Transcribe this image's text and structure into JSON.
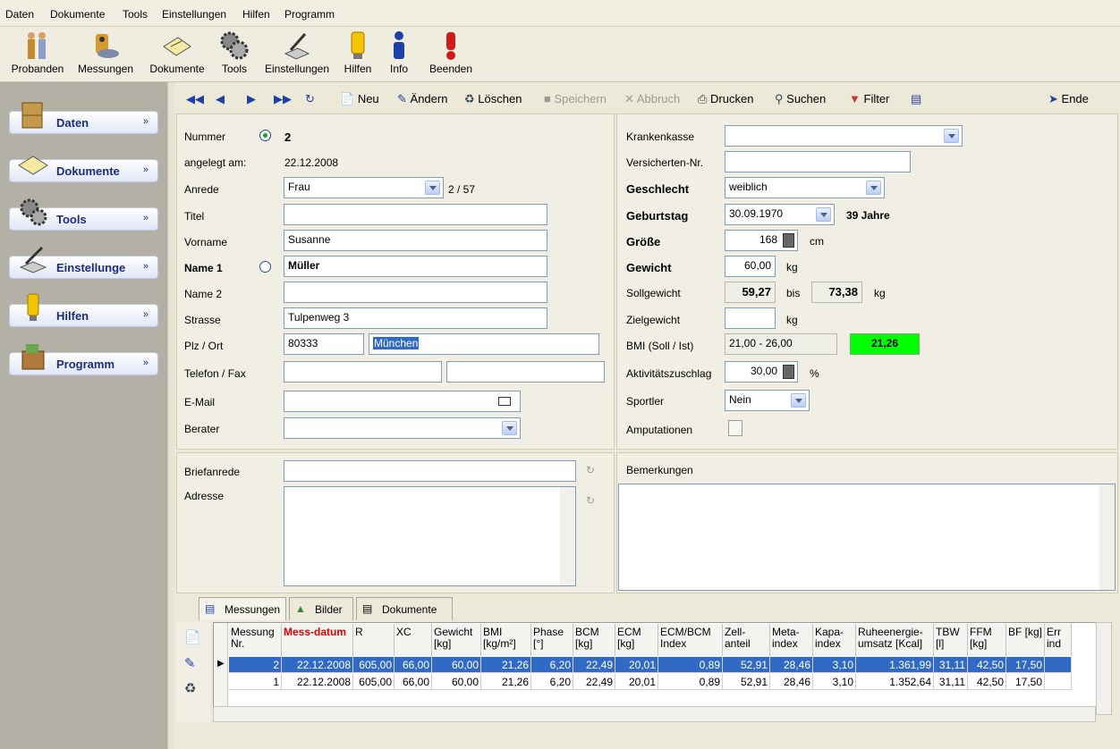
{
  "menu": [
    "Daten",
    "Dokumente",
    "Tools",
    "Einstellungen",
    "Hilfen",
    "Programm"
  ],
  "toolbar": [
    "Probanden",
    "Messungen",
    "Dokumente",
    "Tools",
    "Einstellungen",
    "Hilfen",
    "Info",
    "Beenden"
  ],
  "sidebar": [
    "Daten",
    "Dokumente",
    "Tools",
    "Einstellunge",
    "Hilfen",
    "Programm"
  ],
  "nav": {
    "new": "Neu",
    "edit": "Ändern",
    "delete": "Löschen",
    "save": "Speichern",
    "cancel": "Abbruch",
    "print": "Drucken",
    "search": "Suchen",
    "filter": "Filter",
    "end": "Ende"
  },
  "form": {
    "nummer_label": "Nummer",
    "nummer": "2",
    "angelegt_label": "angelegt am:",
    "angelegt": "22.12.2008",
    "anrede_label": "Anrede",
    "anrede": "Frau",
    "record_pos": "2 / 57",
    "titel_label": "Titel",
    "titel": "",
    "vorname_label": "Vorname",
    "vorname": "Susanne",
    "name1_label": "Name 1",
    "name1": "Müller",
    "name2_label": "Name 2",
    "name2": "",
    "strasse_label": "Strasse",
    "strasse": "Tulpenweg 3",
    "plz_label": "Plz / Ort",
    "plz": "80333",
    "ort": "München",
    "telefon_label": "Telefon / Fax",
    "email_label": "E-Mail",
    "berater_label": "Berater",
    "krankenkasse_label": "Krankenkasse",
    "versnr_label": "Versicherten-Nr.",
    "geschlecht_label": "Geschlecht",
    "geschlecht": "weiblich",
    "geburtstag_label": "Geburtstag",
    "geburtstag": "30.09.1970",
    "alter": "39 Jahre",
    "groesse_label": "Größe",
    "groesse": "168",
    "groesse_unit": "cm",
    "gewicht_label": "Gewicht",
    "gewicht": "60,00",
    "gewicht_unit": "kg",
    "soll_label": "Sollgewicht",
    "soll_min": "59,27",
    "bis": "bis",
    "soll_max": "73,38",
    "soll_unit": "kg",
    "ziel_label": "Zielgewicht",
    "ziel_unit": "kg",
    "bmi_label": "BMI (Soll / Ist)",
    "bmi_soll": "21,00 - 26,00",
    "bmi_ist": "21,26",
    "akt_label": "Aktivitätszuschlag",
    "akt": "30,00",
    "akt_unit": "%",
    "sportler_label": "Sportler",
    "sportler": "Nein",
    "amput_label": "Amputationen",
    "brief_label": "Briefanrede",
    "adresse_label": "Adresse",
    "bemerk_label": "Bemerkungen"
  },
  "tabs": [
    "Messungen",
    "Bilder",
    "Dokumente"
  ],
  "grid": {
    "headers": [
      "Messung Nr.",
      "Mess-datum",
      "R",
      "XC",
      "Gewicht [kg]",
      "BMI [kg/m²]",
      "Phase [°]",
      "BCM [kg]",
      "ECM [kg]",
      "ECM/BCM Index",
      "Zell-anteil",
      "Meta-index",
      "Kapa-index",
      "Ruheenergie-umsatz [Kcal]",
      "TBW [l]",
      "FFM [kg]",
      "BF [kg]",
      "Err ind"
    ],
    "rows": [
      [
        "2",
        "22.12.2008",
        "605,00",
        "66,00",
        "60,00",
        "21,26",
        "6,20",
        "22,49",
        "20,01",
        "0,89",
        "52,91",
        "28,46",
        "3,10",
        "1.361,99",
        "31,11",
        "42,50",
        "17,50",
        ""
      ],
      [
        "1",
        "22.12.2008",
        "605,00",
        "66,00",
        "60,00",
        "21,26",
        "6,20",
        "22,49",
        "20,01",
        "0,89",
        "52,91",
        "28,46",
        "3,10",
        "1.352,64",
        "31,11",
        "42,50",
        "17,50",
        ""
      ]
    ]
  },
  "colors": {
    "bmi_ist_bg": "#00ff00",
    "selected_row": "#316ac5",
    "sidebar_text": "#1a2e7c"
  }
}
